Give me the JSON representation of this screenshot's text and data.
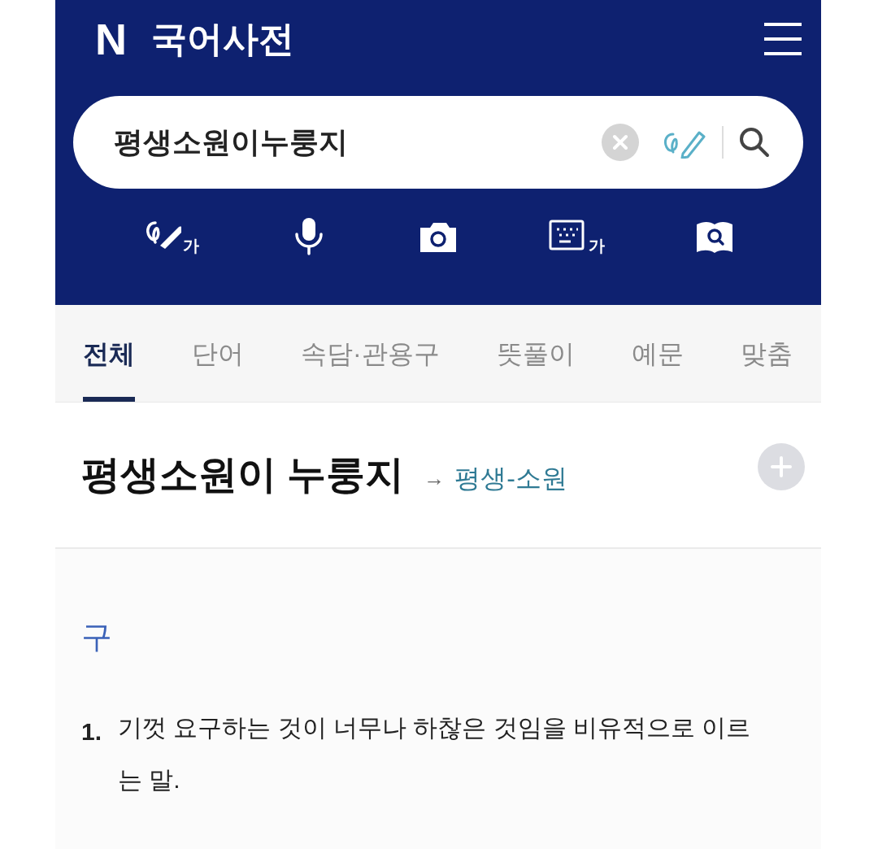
{
  "app": {
    "logo": "N",
    "title": "국어사전"
  },
  "search": {
    "value": "평생소원이누룽지"
  },
  "input_tools": [
    {
      "kind": "handwriting",
      "label": "가"
    },
    {
      "kind": "voice"
    },
    {
      "kind": "camera"
    },
    {
      "kind": "keyboard",
      "label": "가"
    },
    {
      "kind": "book-search"
    }
  ],
  "tabs": [
    {
      "label": "전체",
      "selected": true
    },
    {
      "label": "단어",
      "selected": false
    },
    {
      "label": "속담·관용구",
      "selected": false
    },
    {
      "label": "뜻풀이",
      "selected": false
    },
    {
      "label": "예문",
      "selected": false
    },
    {
      "label": "맞춤",
      "selected": false
    }
  ],
  "entry": {
    "headword": "평생소원이 누룽지",
    "arrow": "→",
    "link": "평생-소원",
    "part_of_speech": "구",
    "definitions": [
      {
        "number": "1.",
        "text": "기껏 요구하는 것이 너무나 하찮은 것임을 비유적으로 이르는 말."
      }
    ]
  }
}
